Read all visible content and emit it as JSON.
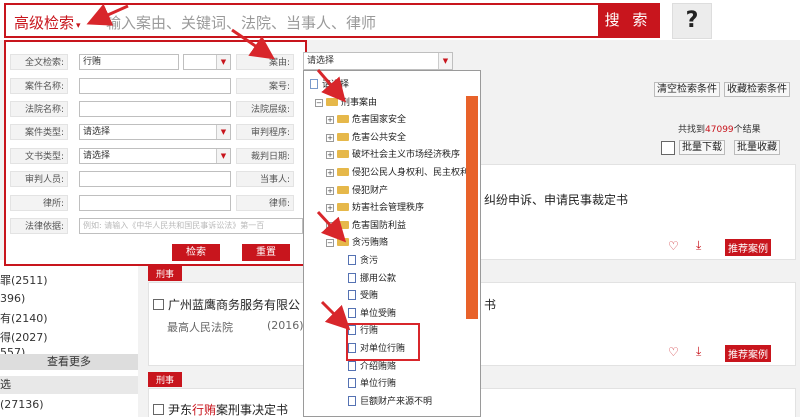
{
  "search": {
    "advanced_label": "高级检索",
    "caret": "▾",
    "placeholder": "输入案由、关键词、法院、当事人、律师",
    "button": "搜 索",
    "help": "?"
  },
  "panel": {
    "fields": [
      {
        "label": "全文检索:",
        "value": "行贿"
      },
      {
        "label": "案件名称:",
        "value": ""
      },
      {
        "label": "法院名称:",
        "value": ""
      },
      {
        "label": "案件类型:",
        "value": "请选择"
      },
      {
        "label": "文书类型:",
        "value": "请选择"
      },
      {
        "label": "审判人员:",
        "value": ""
      },
      {
        "label": "律所:",
        "value": ""
      },
      {
        "label": "法律依据:",
        "value": "例如: 请输入《中华人民共和国民事诉讼法》第一百"
      }
    ],
    "right_labels": [
      "案由:",
      "案号:",
      "法院层级:",
      "审判程序:",
      "裁判日期:",
      "当事人:",
      "律师:"
    ],
    "cause_value": "请选择",
    "search_btn": "检索",
    "reset_btn": "重置"
  },
  "toolbar": {
    "clear": "清空检索条件",
    "save": "收藏检索条件",
    "found_prefix": "共找到",
    "found_count": "47099",
    "found_suffix": "个结果",
    "batch_download": "批量下载",
    "batch_collect": "批量收藏"
  },
  "tree": {
    "items": [
      {
        "text": "请选择",
        "kind": "top"
      },
      {
        "text": "刑事案由",
        "kind": "folder",
        "toggle": "−"
      },
      {
        "text": "危害国家安全",
        "kind": "folder",
        "toggle": "+"
      },
      {
        "text": "危害公共安全",
        "kind": "folder",
        "toggle": "+"
      },
      {
        "text": "破坏社会主义市场经济秩序",
        "kind": "folder",
        "toggle": "+"
      },
      {
        "text": "侵犯公民人身权利、民主权利",
        "kind": "folder",
        "toggle": "+"
      },
      {
        "text": "侵犯财产",
        "kind": "folder",
        "toggle": "+"
      },
      {
        "text": "妨害社会管理秩序",
        "kind": "folder",
        "toggle": "+"
      },
      {
        "text": "危害国防利益",
        "kind": "folder",
        "toggle": "+"
      },
      {
        "text": "贪污贿赂",
        "kind": "folder",
        "toggle": "−"
      },
      {
        "text": "贪污",
        "kind": "doc"
      },
      {
        "text": "挪用公款",
        "kind": "doc"
      },
      {
        "text": "受贿",
        "kind": "doc"
      },
      {
        "text": "单位受贿",
        "kind": "doc"
      },
      {
        "text": "行贿",
        "kind": "doc"
      },
      {
        "text": "对单位行贿",
        "kind": "doc"
      },
      {
        "text": "介绍贿赂",
        "kind": "doc"
      },
      {
        "text": "单位行贿",
        "kind": "doc"
      },
      {
        "text": "巨额财产来源不明",
        "kind": "doc"
      }
    ]
  },
  "left_counts": [
    "罪(2511)",
    "396)",
    "有(2140)",
    "得(2027)",
    "557)"
  ],
  "left_seemore": "查看更多",
  "left_filter": "选",
  "left_filter_count": "(27136)",
  "results": [
    {
      "title_tail": "纠纷申诉、申请民事裁定书",
      "recommend": "推荐案例"
    },
    {
      "tag": "刑事",
      "title": "广州蓝鹰商务服务有限公",
      "title_tail": "书",
      "court": "最高人民法院",
      "year": "(2016)",
      "recommend": "推荐案例"
    },
    {
      "tag": "刑事",
      "title_pre": "尹东",
      "title_hl": "行贿",
      "title_post": "案刑事决定书"
    }
  ],
  "colors": {
    "brand": "#c8151d",
    "scroll": "#e8622a"
  }
}
